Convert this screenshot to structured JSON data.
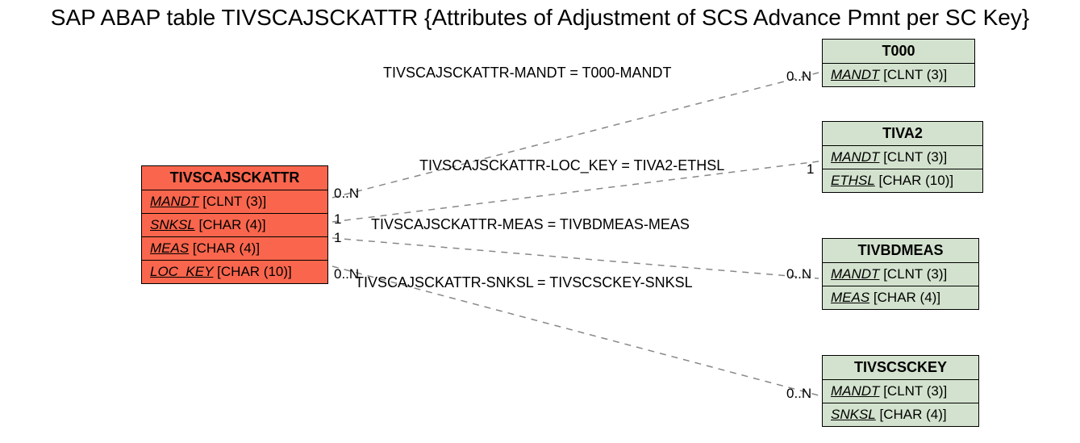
{
  "title": "SAP ABAP table TIVSCAJSCKATTR {Attributes of Adjustment of SCS Advance Pmnt per SC Key}",
  "main": {
    "name": "TIVSCAJSCKATTR",
    "rows": {
      "r0": {
        "key": "MANDT",
        "type": "[CLNT (3)]"
      },
      "r1": {
        "key": "SNKSL",
        "type": "[CHAR (4)]"
      },
      "r2": {
        "key": "MEAS",
        "type": "[CHAR (4)]"
      },
      "r3": {
        "key": "LOC_KEY",
        "type": "[CHAR (10)]"
      }
    }
  },
  "refs": {
    "t000": {
      "name": "T000",
      "rows": {
        "r0": {
          "key": "MANDT",
          "type": "[CLNT (3)]"
        }
      }
    },
    "tiva2": {
      "name": "TIVA2",
      "rows": {
        "r0": {
          "key": "MANDT",
          "type": "[CLNT (3)]"
        },
        "r1": {
          "key": "ETHSL",
          "type": "[CHAR (10)]"
        }
      }
    },
    "tivbdmeas": {
      "name": "TIVBDMEAS",
      "rows": {
        "r0": {
          "key": "MANDT",
          "type": "[CLNT (3)]"
        },
        "r1": {
          "key": "MEAS",
          "type": "[CHAR (4)]"
        }
      }
    },
    "tivscsckey": {
      "name": "TIVSCSCKEY",
      "rows": {
        "r0": {
          "key": "MANDT",
          "type": "[CLNT (3)]"
        },
        "r1": {
          "key": "SNKSL",
          "type": "[CHAR (4)]"
        }
      }
    }
  },
  "rels": {
    "r1": {
      "label": "TIVSCAJSCKATTR-MANDT = T000-MANDT",
      "cardL": "0..N",
      "cardR": "0..N"
    },
    "r2": {
      "label": "TIVSCAJSCKATTR-LOC_KEY = TIVA2-ETHSL",
      "cardL": "1",
      "cardR": "1"
    },
    "r3": {
      "label": "TIVSCAJSCKATTR-MEAS = TIVBDMEAS-MEAS",
      "cardL": "1",
      "cardR": "0..N"
    },
    "r4": {
      "label": "TIVSCAJSCKATTR-SNKSL = TIVSCSCKEY-SNKSL",
      "cardL": "0..N",
      "cardR": "0..N"
    }
  }
}
